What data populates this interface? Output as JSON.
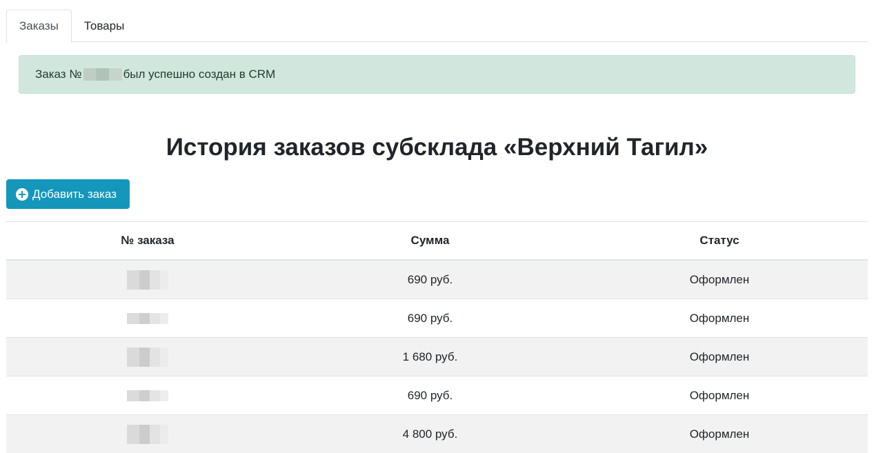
{
  "tabs": [
    {
      "label": "Заказы",
      "active": true
    },
    {
      "label": "Товары",
      "active": false
    }
  ],
  "alert": {
    "prefix": "Заказ №",
    "suffix": "был успешно создан в CRM"
  },
  "title": "История заказов субсклада «Верхний Тагил»",
  "add_button": {
    "label": "Добавить заказ",
    "icon": "plus-circle-icon"
  },
  "table": {
    "columns": [
      "№ заказа",
      "Сумма",
      "Статус"
    ],
    "rows": [
      {
        "sum": "690 руб.",
        "status": "Оформлен"
      },
      {
        "sum": "690 руб.",
        "status": "Оформлен"
      },
      {
        "sum": "1 680 руб.",
        "status": "Оформлен"
      },
      {
        "sum": "690 руб.",
        "status": "Оформлен"
      },
      {
        "sum": "4 800 руб.",
        "status": "Оформлен"
      }
    ]
  },
  "colors": {
    "accent": "#1497bb",
    "alert_bg": "#d1e7dd",
    "stripe": "#f2f2f2"
  }
}
